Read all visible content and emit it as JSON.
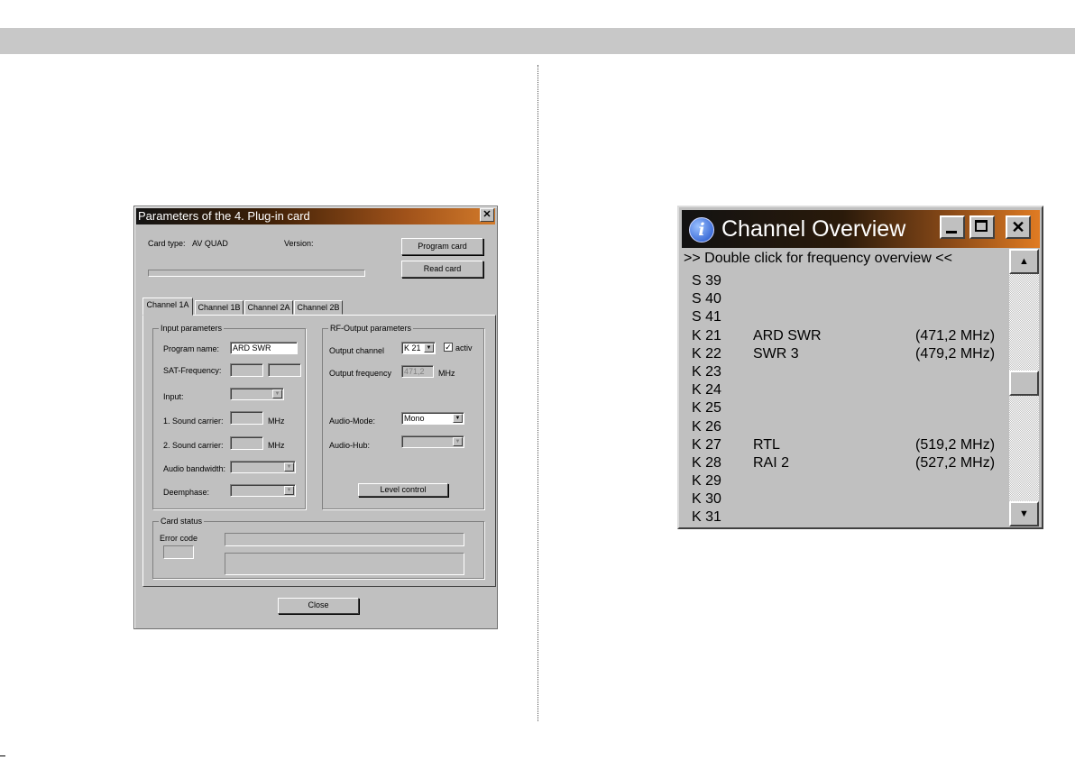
{
  "params_dialog": {
    "title": "Parameters of the 4. Plug-in card",
    "close_glyph": "✕",
    "card_type_label": "Card type:",
    "card_type_value": "AV QUAD",
    "version_label": "Version:",
    "program_card_label": "Program card",
    "read_card_label": "Read card",
    "tabs": [
      "Channel 1A",
      "Channel 1B",
      "Channel 2A",
      "Channel 2B"
    ],
    "input_group": {
      "legend": "Input parameters",
      "program_name_label": "Program name:",
      "program_name_value": "ARD SWR",
      "sat_frequency_label": "SAT-Frequency:",
      "input_label": "Input:",
      "sound1_label": "1. Sound carrier:",
      "sound2_label": "2. Sound carrier:",
      "mhz": "MHz",
      "audio_bandwidth_label": "Audio bandwidth:",
      "deemphase_label": "Deemphase:"
    },
    "rf_group": {
      "legend": "RF-Output parameters",
      "output_channel_label": "Output channel",
      "output_channel_value": "K 21",
      "activ_label": "activ",
      "activ_check": "✓",
      "output_frequency_label": "Output frequency",
      "output_frequency_value": "471,2",
      "mhz": "MHz",
      "audio_mode_label": "Audio-Mode:",
      "audio_mode_value": "Mono",
      "audio_hub_label": "Audio-Hub:",
      "level_control_label": "Level control"
    },
    "status_group": {
      "legend": "Card status",
      "error_code_label": "Error code"
    },
    "close_label": "Close"
  },
  "channel_overview": {
    "title": "Channel Overview",
    "info_glyph": "i",
    "subtitle": ">> Double click for frequency overview <<",
    "rows": [
      {
        "ch": "S 39",
        "name": "",
        "freq": ""
      },
      {
        "ch": "S 40",
        "name": "",
        "freq": ""
      },
      {
        "ch": "S 41",
        "name": "",
        "freq": ""
      },
      {
        "ch": "K 21",
        "name": "ARD SWR",
        "freq": "(471,2 MHz)"
      },
      {
        "ch": "K 22",
        "name": "SWR 3",
        "freq": "(479,2 MHz)"
      },
      {
        "ch": "K 23",
        "name": "",
        "freq": ""
      },
      {
        "ch": "K 24",
        "name": "",
        "freq": ""
      },
      {
        "ch": "K 25",
        "name": "",
        "freq": ""
      },
      {
        "ch": "K 26",
        "name": "",
        "freq": ""
      },
      {
        "ch": "K 27",
        "name": "RTL",
        "freq": "(519,2 MHz)"
      },
      {
        "ch": "K 28",
        "name": "RAI 2",
        "freq": "(527,2 MHz)"
      },
      {
        "ch": "K 29",
        "name": "",
        "freq": ""
      },
      {
        "ch": "K 30",
        "name": "",
        "freq": ""
      },
      {
        "ch": "K 31",
        "name": "",
        "freq": ""
      }
    ]
  }
}
